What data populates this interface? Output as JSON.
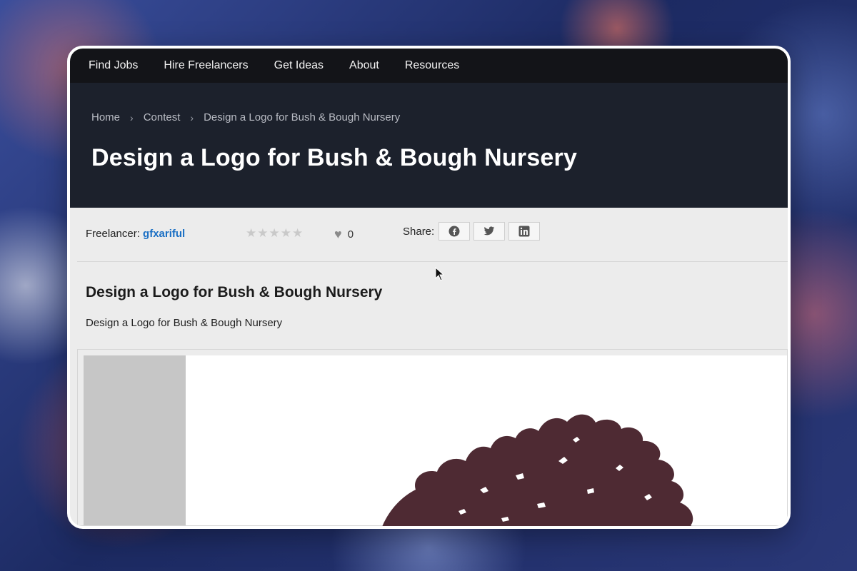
{
  "nav": {
    "items": [
      "Find Jobs",
      "Hire Freelancers",
      "Get Ideas",
      "About",
      "Resources"
    ]
  },
  "breadcrumb": {
    "items": [
      "Home",
      "Contest",
      "Design a Logo for Bush & Bough Nursery"
    ],
    "separator": "›"
  },
  "page": {
    "title": "Design a Logo for Bush & Bough Nursery"
  },
  "meta": {
    "freelancer_label": "Freelancer:",
    "freelancer_name": "gfxariful",
    "rating_stars": 0,
    "rating_max": 5,
    "likes_count": "0",
    "share_label": "Share:",
    "share_icons": [
      "facebook-icon",
      "twitter-icon",
      "linkedin-icon"
    ]
  },
  "entry": {
    "title": "Design a Logo for Bush & Bough Nursery",
    "description": "Design a Logo for Bush & Bough Nursery"
  },
  "colors": {
    "nav_bg": "#131418",
    "hero_bg": "#1c212c",
    "link": "#1a6fc4",
    "tree": "#4e2a33"
  }
}
